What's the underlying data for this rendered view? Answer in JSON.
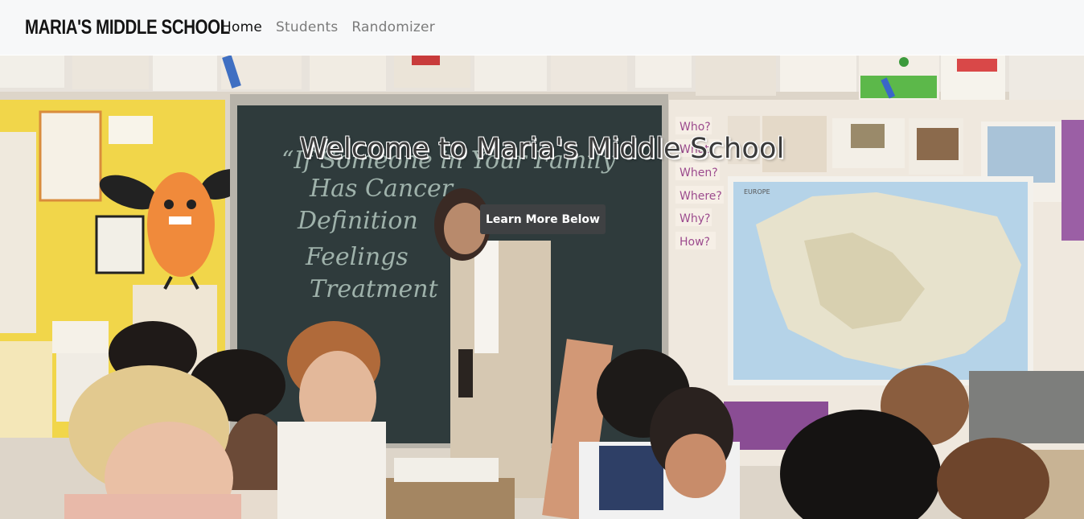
{
  "navbar": {
    "brand": "MARIA'S MIDDLE SCHOOL",
    "links": [
      {
        "label": "Home",
        "active": true
      },
      {
        "label": "Students",
        "active": false
      },
      {
        "label": "Randomizer",
        "active": false
      }
    ]
  },
  "hero": {
    "title": "Welcome to Maria's Middle School",
    "button_label": "Learn More Below",
    "chalkboard_lines": [
      "“If Someone in Your Family",
      "Has Cancer",
      "Definition",
      "Feelings",
      "Treatment"
    ],
    "question_cards": [
      "Who?",
      "What?",
      "When?",
      "Where?",
      "Why?",
      "How?"
    ],
    "map_label": "EUROPE"
  },
  "colors": {
    "navbar_bg": "#f7f8f9",
    "button_bg": "#3f4143",
    "chalkboard": "#2f3b3c",
    "wall_yellow": "#f1d64a"
  }
}
